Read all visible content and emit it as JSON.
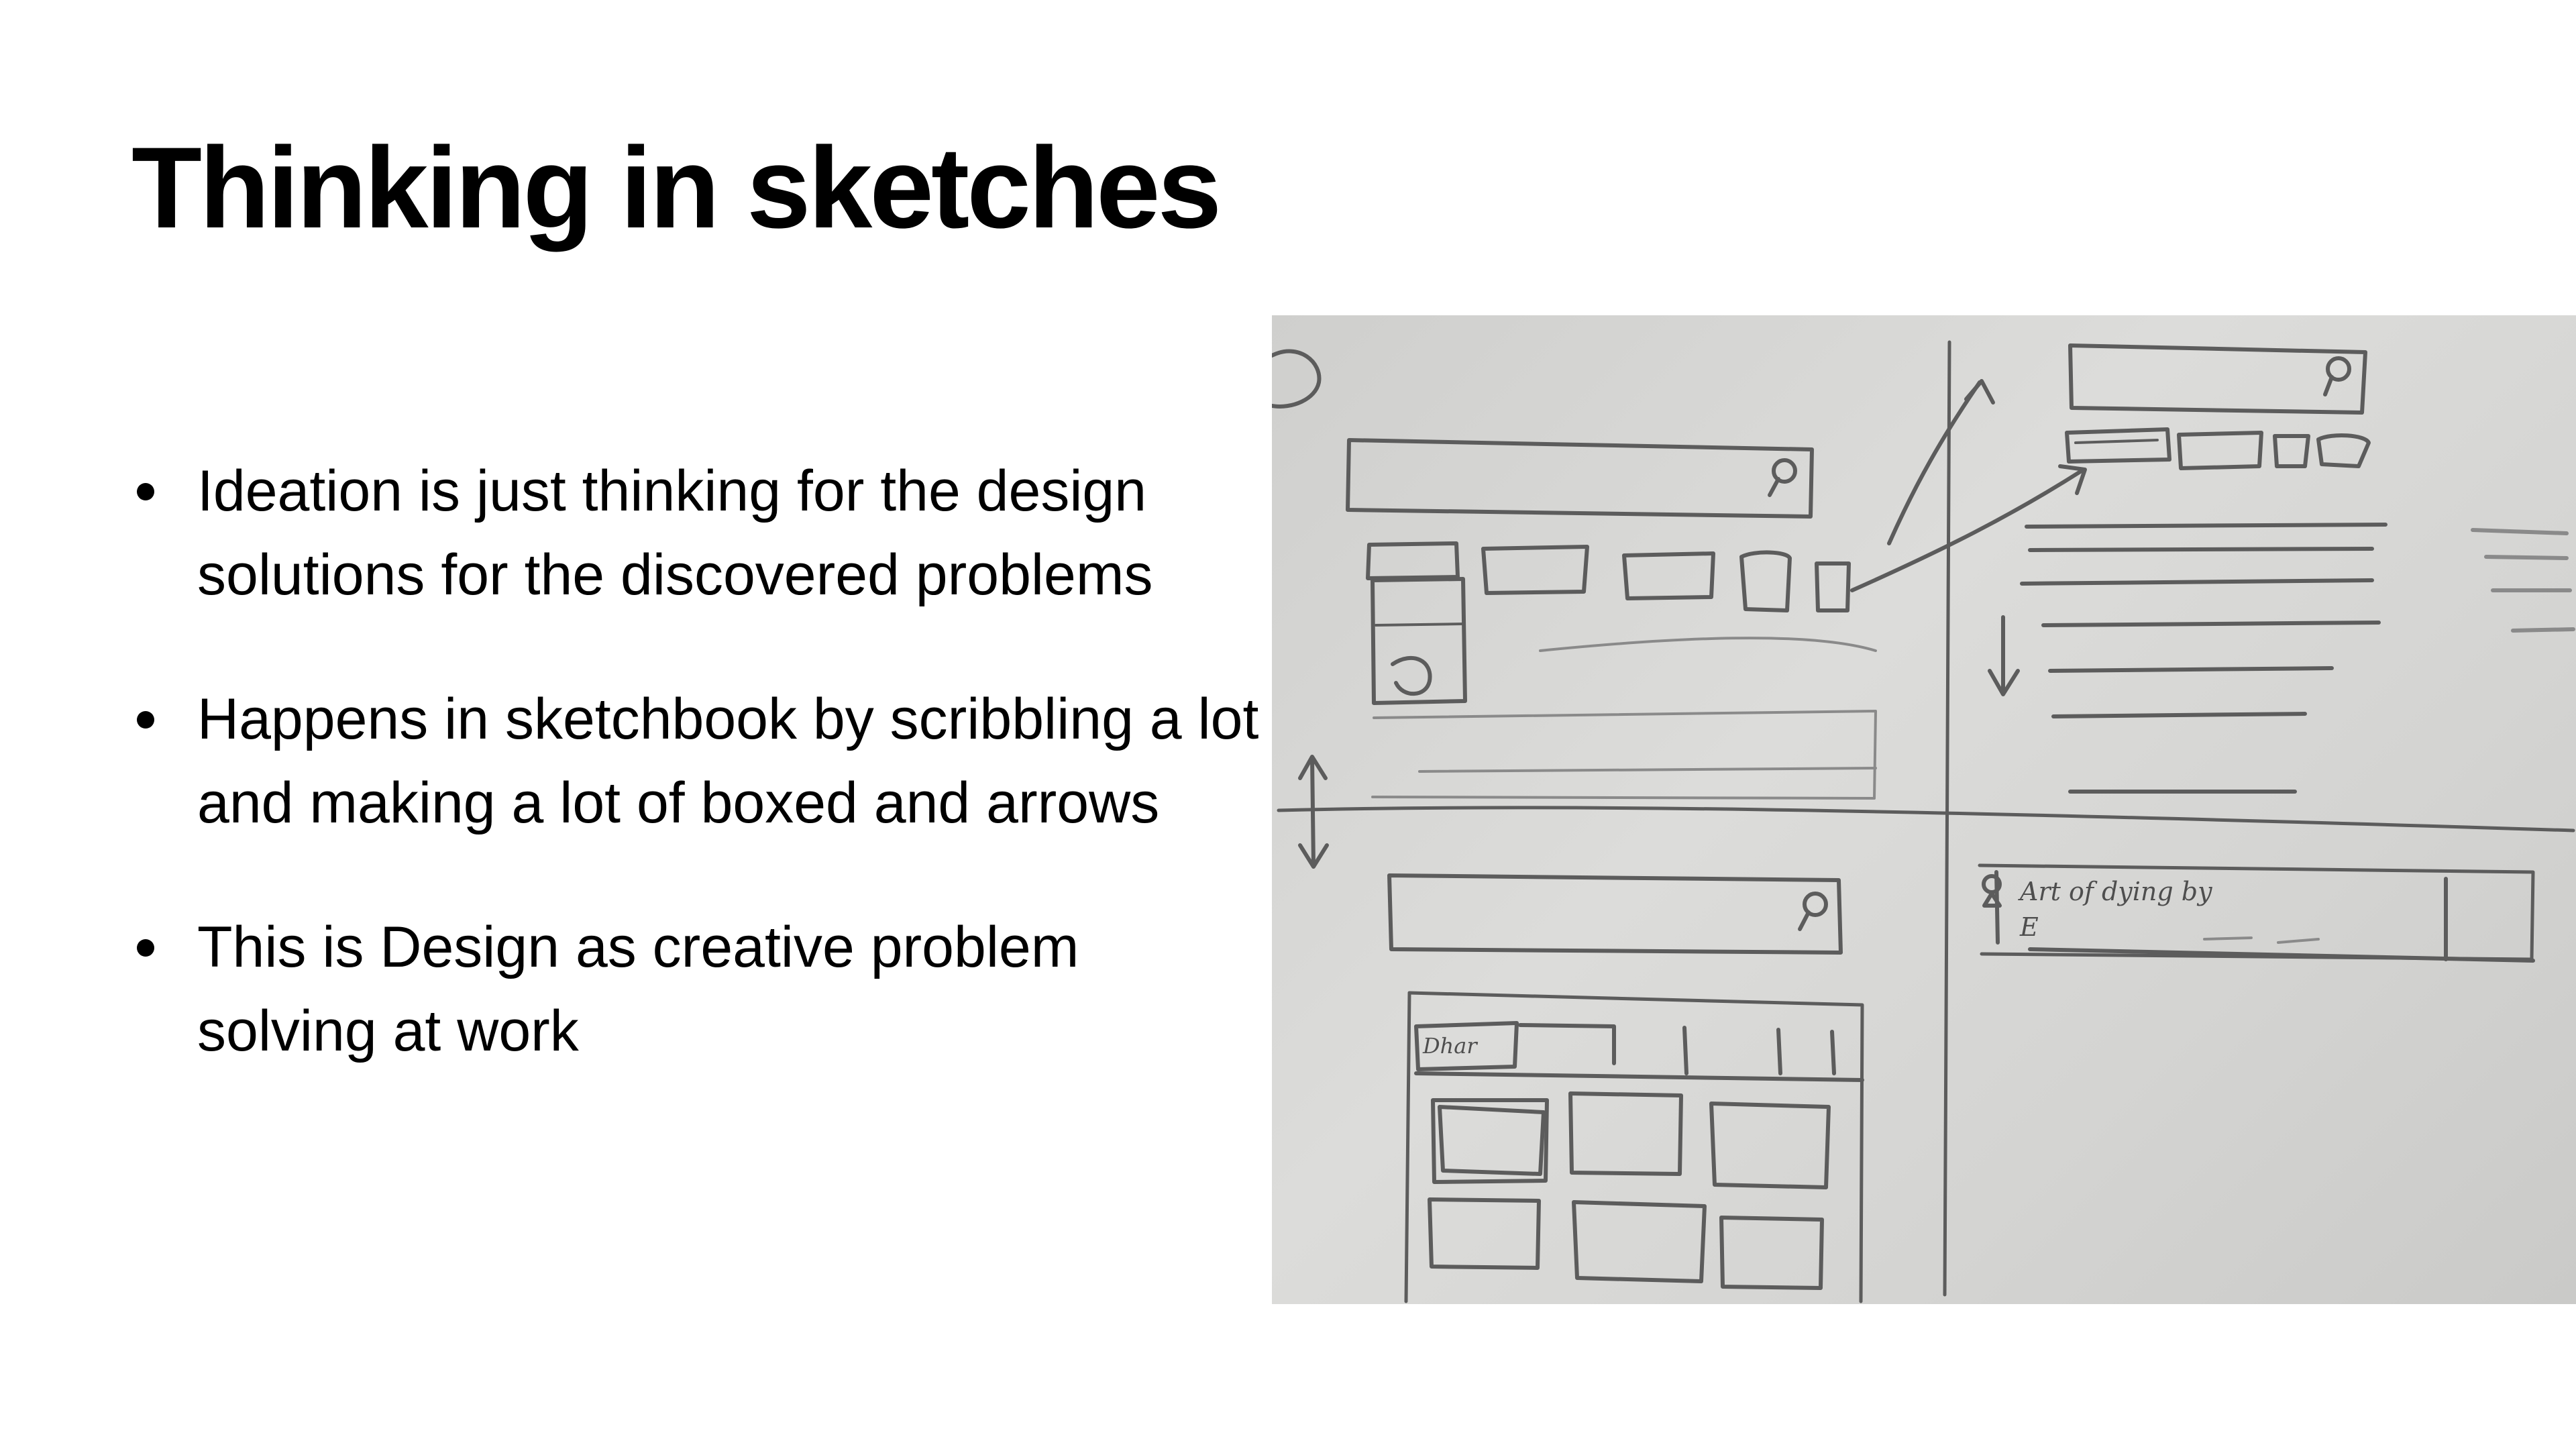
{
  "slide": {
    "title": "Thinking in sketches",
    "bullets": [
      "Ideation is just thinking for the design solutions for the discovered problems",
      "Happens in sketchbook by scribbling a lot and making a lot of boxed and arrows",
      "This is Design as creative problem solving at work"
    ]
  },
  "photo": {
    "subject": "pencil-sketch-wireframes",
    "handwriting": [
      "Art of dying by",
      "E"
    ]
  }
}
